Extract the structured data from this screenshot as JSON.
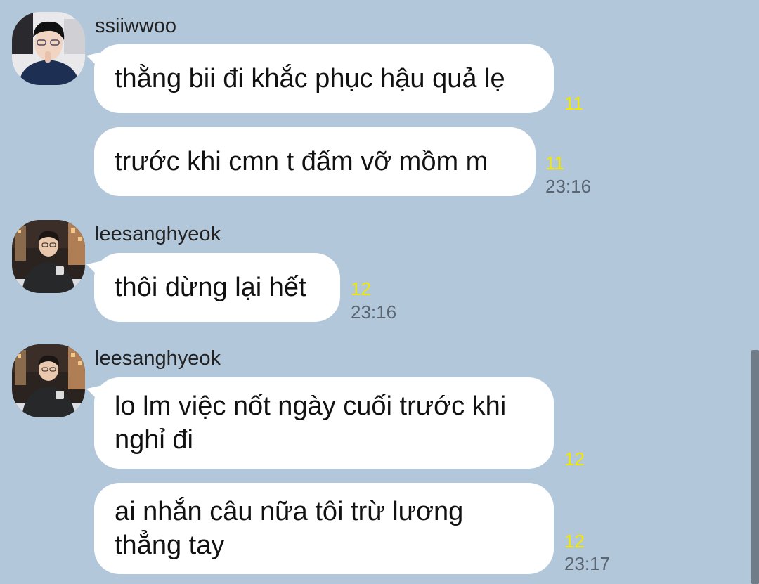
{
  "colors": {
    "background": "#b2c7da",
    "bubble": "#ffffff",
    "unread": "#f2e800",
    "time": "#5a6572"
  },
  "groups": [
    {
      "username": "ssiiwwoo",
      "avatar_icon": "profile-photo-icon",
      "messages": [
        {
          "text": "thằng bii đi khắc phục hậu quả lẹ",
          "unread": "11",
          "time": ""
        },
        {
          "text": "trước khi cmn t đấm vỡ mồm m",
          "unread": "11",
          "time": "23:16"
        }
      ]
    },
    {
      "username": "leesanghyeok",
      "avatar_icon": "profile-photo-icon",
      "messages": [
        {
          "text": "thôi dừng lại hết",
          "unread": "12",
          "time": "23:16"
        }
      ]
    },
    {
      "username": "leesanghyeok",
      "avatar_icon": "profile-photo-icon",
      "messages": [
        {
          "text": "lo lm việc nốt ngày cuối trước khi\nnghỉ đi",
          "unread": "12",
          "time": ""
        },
        {
          "text": "ai nhắn câu nữa tôi trừ lương\nthẳng tay",
          "unread": "12",
          "time": "23:17"
        }
      ]
    }
  ]
}
